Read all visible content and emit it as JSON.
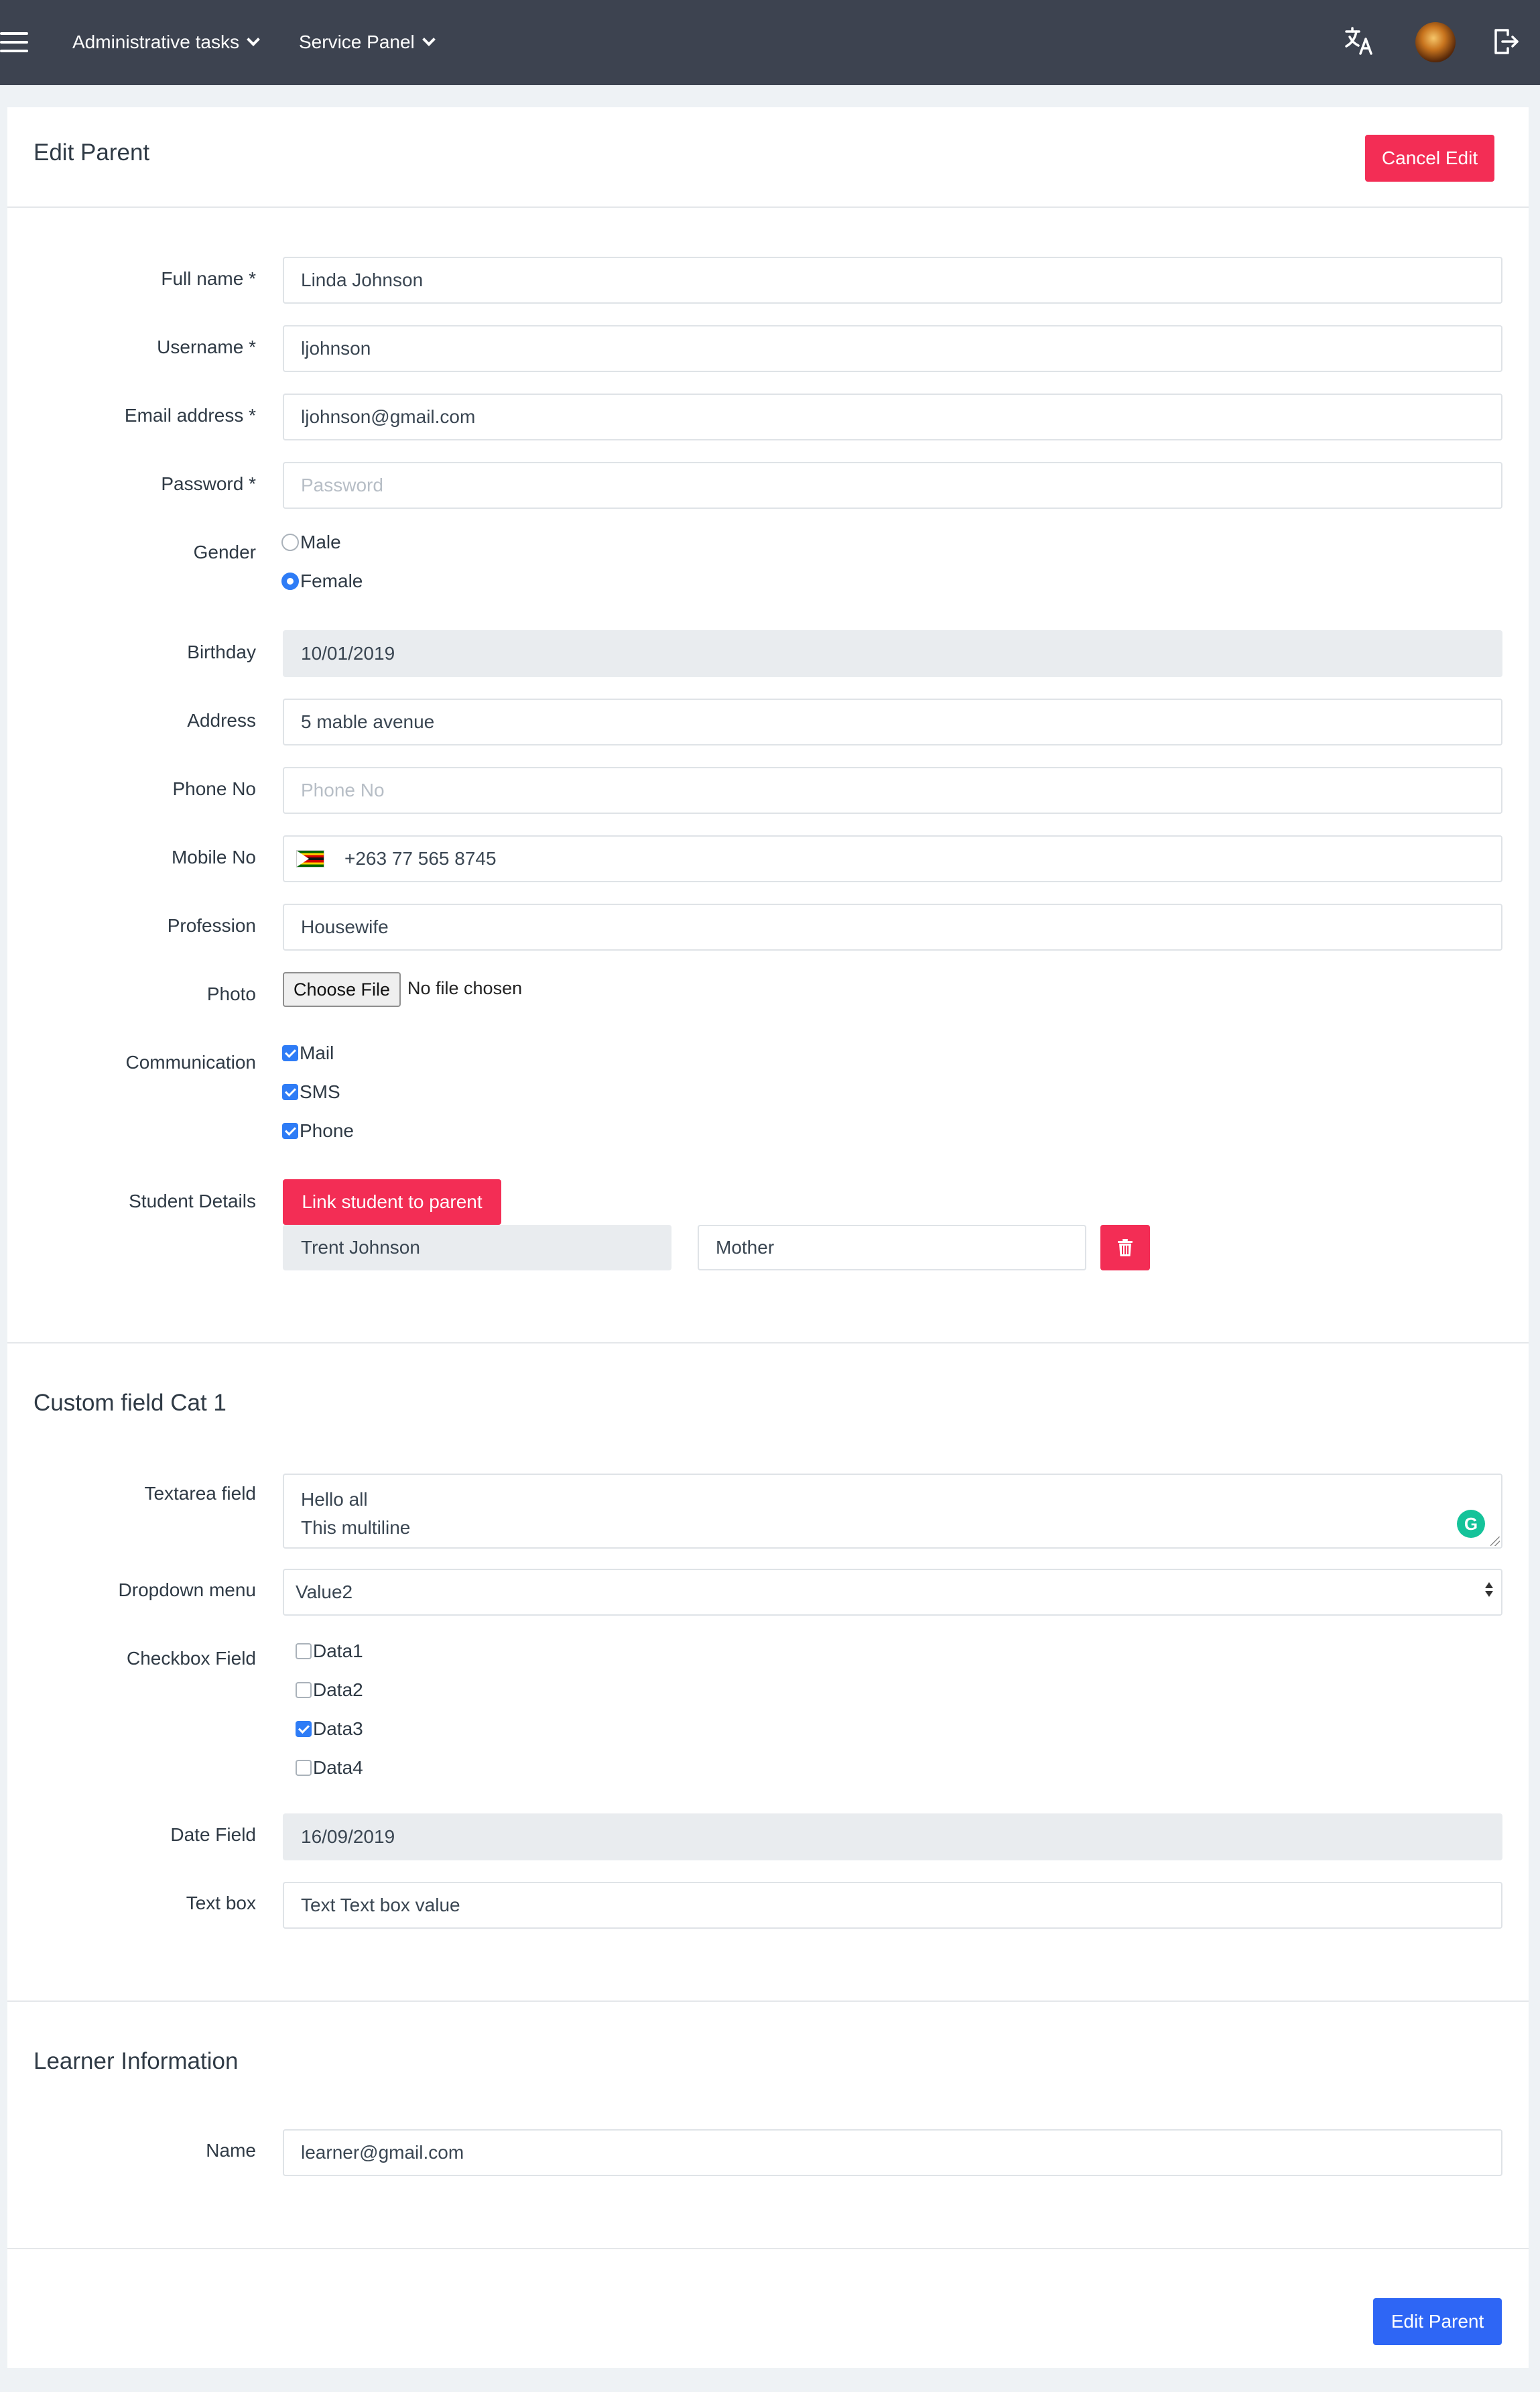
{
  "navbar": {
    "menu_1": "Administrative tasks",
    "menu_2": "Service Panel",
    "icons": [
      "menu-icon",
      "translate-icon",
      "avatar",
      "logout-icon"
    ]
  },
  "header": {
    "title": "Edit Parent",
    "cancel_label": "Cancel Edit"
  },
  "form": {
    "full_name": {
      "label": "Full name *",
      "value": "Linda Johnson"
    },
    "username": {
      "label": "Username *",
      "value": "ljohnson"
    },
    "email": {
      "label": "Email address *",
      "value": "ljohnson@gmail.com"
    },
    "password": {
      "label": "Password *",
      "placeholder": "Password"
    },
    "gender": {
      "label": "Gender",
      "options": [
        "Male",
        "Female"
      ],
      "selected": "Female"
    },
    "birthday": {
      "label": "Birthday",
      "value": "10/01/2019"
    },
    "address": {
      "label": "Address",
      "value": "5 mable avenue"
    },
    "phone": {
      "label": "Phone No",
      "placeholder": "Phone No"
    },
    "mobile": {
      "label": "Mobile No",
      "value": "+263 77 565 8745"
    },
    "profession": {
      "label": "Profession",
      "value": "Housewife"
    },
    "photo": {
      "label": "Photo",
      "button": "Choose File",
      "status": "No file chosen"
    },
    "communication": {
      "label": "Communication",
      "options": [
        "Mail",
        "SMS",
        "Phone"
      ],
      "checked": [
        true,
        true,
        true
      ]
    },
    "student_details": {
      "label": "Student Details",
      "link_button": "Link student to parent",
      "student_name": "Trent Johnson",
      "relation": "Mother"
    }
  },
  "custom_section": {
    "title": "Custom field Cat 1",
    "textarea": {
      "label": "Textarea field",
      "line1": "Hello all",
      "line2": "This multiline"
    },
    "dropdown": {
      "label": "Dropdown menu",
      "value": "Value2"
    },
    "checkbox_field": {
      "label": "Checkbox Field",
      "options": [
        "Data1",
        "Data2",
        "Data3",
        "Data4"
      ],
      "checked": [
        false,
        false,
        true,
        false
      ]
    },
    "date_field": {
      "label": "Date Field",
      "value": "16/09/2019"
    },
    "text_box": {
      "label": "Text box",
      "value": "Text Text box value"
    }
  },
  "learner_section": {
    "title": "Learner Information",
    "name": {
      "label": "Name",
      "value": "learner@gmail.com"
    }
  },
  "footer": {
    "submit_label": "Edit Parent"
  },
  "colors": {
    "navbar": "#3d4350",
    "danger": "#f32d55",
    "primary": "#2e66f5",
    "check": "#2e7cf6",
    "readonly_bg": "#e9ecef"
  }
}
